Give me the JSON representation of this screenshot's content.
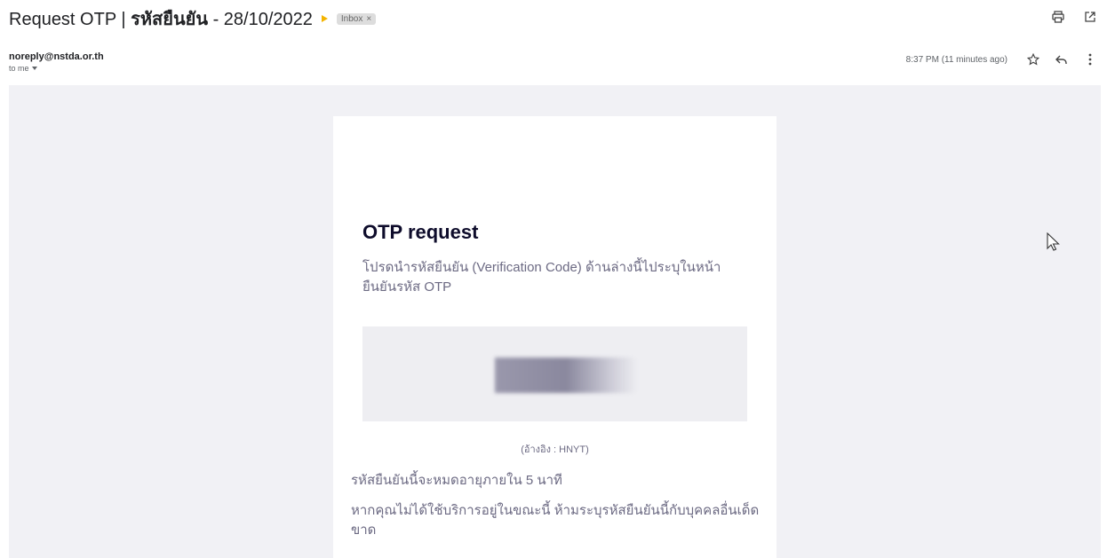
{
  "subject": {
    "prefix": "Request OTP | ",
    "thai": "รหัสยืนยัน",
    "suffix": " - 28/10/2022"
  },
  "label": {
    "text": "Inbox",
    "remove": "×"
  },
  "sender": {
    "email": "noreply@nstda.or.th",
    "to": "to me"
  },
  "time": "8:37 PM (11 minutes ago)",
  "icons": {
    "print": "printer-icon",
    "newwindow": "open-in-new-window-icon",
    "star": "star-icon",
    "reply": "reply-icon",
    "more": "more-vert-icon",
    "important": "important-marker-icon"
  },
  "email": {
    "heading": "OTP request",
    "intro": "โปรดนำรหัสยืนยัน (Verification Code) ด้านล่างนี้ไประบุในหน้ายืนยันรหัส OTP",
    "reference": "(อ้างอิง : HNYT)",
    "expire": "รหัสยืนยันนี้จะหมดอายุภายใน 5 นาที",
    "warning": "หากคุณไม่ได้ใช้บริการอยู่ในขณะนี้ ห้ามระบุรหัสยืนยันนี้กับบุคคลอื่นเด็ดขาด"
  },
  "colors": {
    "background": "#f1f1f5",
    "card": "#ffffff",
    "heading": "#0e0c2b",
    "body_text": "#6c6a83",
    "important": "#f4b400"
  }
}
